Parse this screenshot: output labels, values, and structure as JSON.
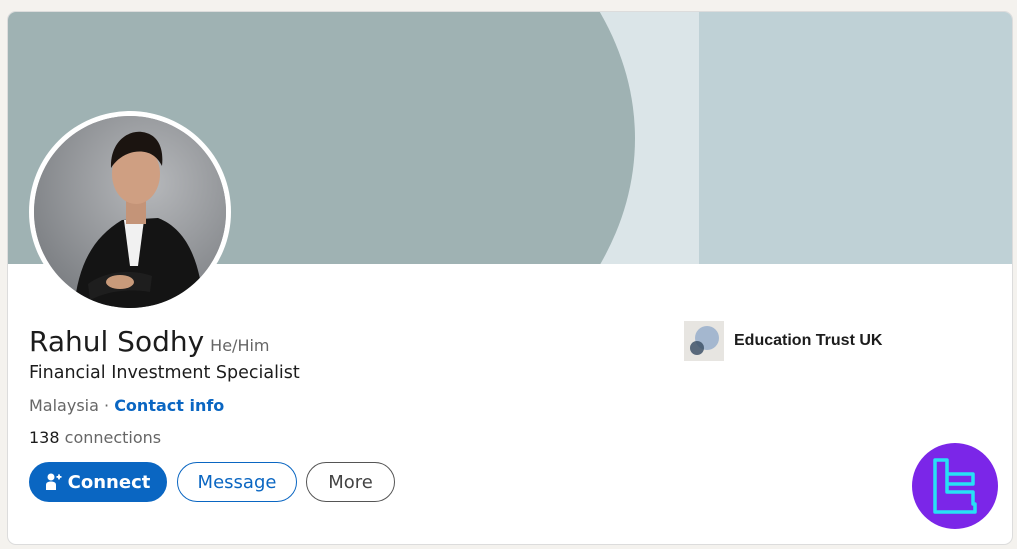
{
  "profile": {
    "name": "Rahul Sodhy",
    "pronouns": "He/Him",
    "headline": "Financial Investment Specialist",
    "location": "Malaysia",
    "separator": "·",
    "contact_info_label": "Contact info",
    "connections_count": "138",
    "connections_label": "connections"
  },
  "actions": {
    "connect_label": "Connect",
    "message_label": "Message",
    "more_label": "More"
  },
  "company": {
    "name": "Education Trust UK",
    "logo_icon": "company-logo-icon"
  },
  "icons": {
    "connect": "add-person-icon",
    "brand": "brand-logo-icon"
  },
  "colors": {
    "accent": "#0a66c2",
    "banner_left": "#9fb2b3",
    "banner_mid": "#dbe5e8",
    "banner_right": "#bfd1d6",
    "brand_badge": "#7b26e8",
    "brand_mark": "#27e0f5"
  }
}
